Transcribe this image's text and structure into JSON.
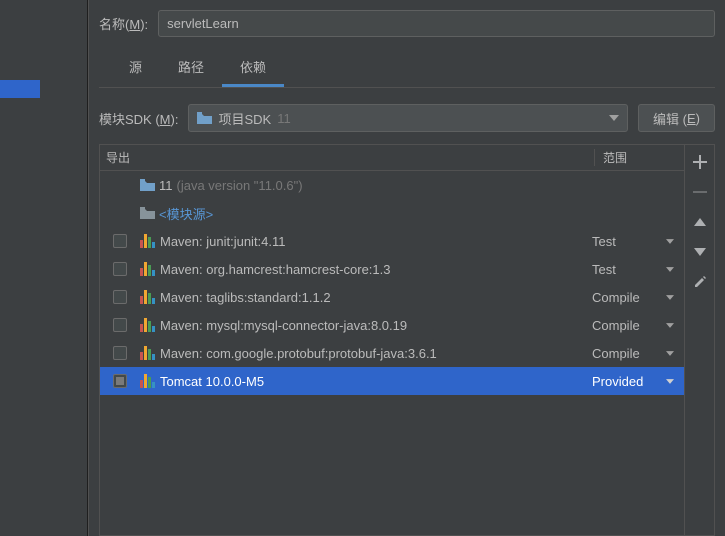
{
  "nameLabel": {
    "prefix": "名称(",
    "mnemonic": "M",
    "suffix": "):"
  },
  "nameValue": "servletLearn",
  "tabs": [
    {
      "label": "源",
      "active": false
    },
    {
      "label": "路径",
      "active": false
    },
    {
      "label": "依赖",
      "active": true
    }
  ],
  "sdkLabel": {
    "prefix": "模块SDK (",
    "mnemonic": "M",
    "suffix": "):"
  },
  "sdk": {
    "name": "项目SDK",
    "version": "11"
  },
  "editBtn": {
    "prefix": "编辑 (",
    "mnemonic": "E",
    "suffix": ")"
  },
  "headers": {
    "export": "导出",
    "scope": "范围"
  },
  "specialRows": {
    "jdk": {
      "name": "11",
      "version": "(java version \"11.0.6\")"
    },
    "moduleSource": "<模块源>"
  },
  "deps": [
    {
      "name": "Maven: junit:junit:4.11",
      "scope": "Test",
      "checked": false,
      "selected": false
    },
    {
      "name": "Maven: org.hamcrest:hamcrest-core:1.3",
      "scope": "Test",
      "checked": false,
      "selected": false
    },
    {
      "name": "Maven: taglibs:standard:1.1.2",
      "scope": "Compile",
      "checked": false,
      "selected": false
    },
    {
      "name": "Maven: mysql:mysql-connector-java:8.0.19",
      "scope": "Compile",
      "checked": false,
      "selected": false
    },
    {
      "name": "Maven: com.google.protobuf:protobuf-java:3.6.1",
      "scope": "Compile",
      "checked": false,
      "selected": false
    },
    {
      "name": "Tomcat 10.0.0-M5",
      "scope": "Provided",
      "checked": true,
      "selected": true
    }
  ],
  "tools": [
    "add",
    "remove",
    "up",
    "down",
    "edit"
  ]
}
